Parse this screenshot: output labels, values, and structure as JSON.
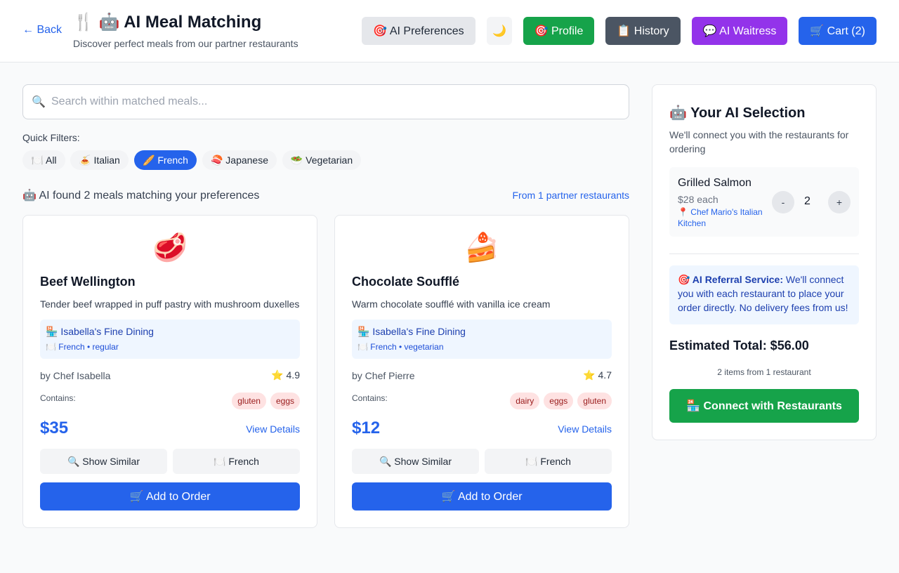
{
  "header": {
    "back_label": "← Back",
    "title": "🍴 🤖 AI Meal Matching",
    "subtitle": "Discover perfect meals from our partner restaurants",
    "buttons": {
      "preferences": "🎯 AI Preferences",
      "dark_mode": "🌙",
      "profile": "🎯 Profile",
      "history": "📋 History",
      "waitress": "💬 AI Waitress",
      "cart": "🛒 Cart (2)"
    }
  },
  "search": {
    "icon": "🔍",
    "placeholder": "Search within matched meals...",
    "value": ""
  },
  "filters": {
    "label": "Quick Filters:",
    "chips": [
      "🍽️ All",
      "🍝 Italian",
      "🥖 French",
      "🍣 Japanese",
      "🥗 Vegetarian"
    ],
    "active": "🥖 French"
  },
  "results": {
    "found_text": "🤖 AI found 2 meals matching your preferences",
    "partners_text": "From 1 partner restaurants"
  },
  "meals": [
    {
      "emoji": "🥩",
      "name": "Beef Wellington",
      "description": "Tender beef wrapped in puff pastry with mushroom duxelles",
      "restaurant": "🏪 Isabella's Fine Dining",
      "restaurant_meta": "🍽️ French • regular",
      "chef": "by Chef Isabella",
      "rating": "⭐ 4.9",
      "contains_label": "Contains:",
      "allergens": [
        "gluten",
        "eggs"
      ],
      "price": "$35",
      "details_label": "View Details",
      "similar_label": "🔍 Show Similar",
      "cuisine_label": "🍽️ French",
      "add_label": "🛒 Add to Order"
    },
    {
      "emoji": "🍰",
      "name": "Chocolate Soufflé",
      "description": "Warm chocolate soufflé with vanilla ice cream",
      "restaurant": "🏪 Isabella's Fine Dining",
      "restaurant_meta": "🍽️ French • vegetarian",
      "chef": "by Chef Pierre",
      "rating": "⭐ 4.7",
      "contains_label": "Contains:",
      "allergens": [
        "dairy",
        "eggs",
        "gluten"
      ],
      "price": "$12",
      "details_label": "View Details",
      "similar_label": "🔍 Show Similar",
      "cuisine_label": "🍽️ French",
      "add_label": "🛒 Add to Order"
    }
  ],
  "selection": {
    "title": "🤖 Your AI Selection",
    "description": "We'll connect you with the restaurants for ordering",
    "item": {
      "name": "Grilled Salmon",
      "price": "$28 each",
      "restaurant": "📍 Chef Mario's Italian Kitchen",
      "minus": "-",
      "quantity": "2",
      "plus": "+"
    },
    "referral_bold": "🎯 AI Referral Service:",
    "referral_text": " We'll connect you with each restaurant to place your order directly. No delivery fees from us!",
    "total": "Estimated Total: $56.00",
    "total_sub": "2 items from 1 restaurant",
    "connect_label": "🏪 Connect with Restaurants"
  },
  "colors": {
    "primary": "#2563eb",
    "success": "#16a34a",
    "purple": "#9333ea",
    "slate": "#4b5563",
    "allergen_bg": "#fee2e2",
    "allergen_text": "#991b1b"
  }
}
